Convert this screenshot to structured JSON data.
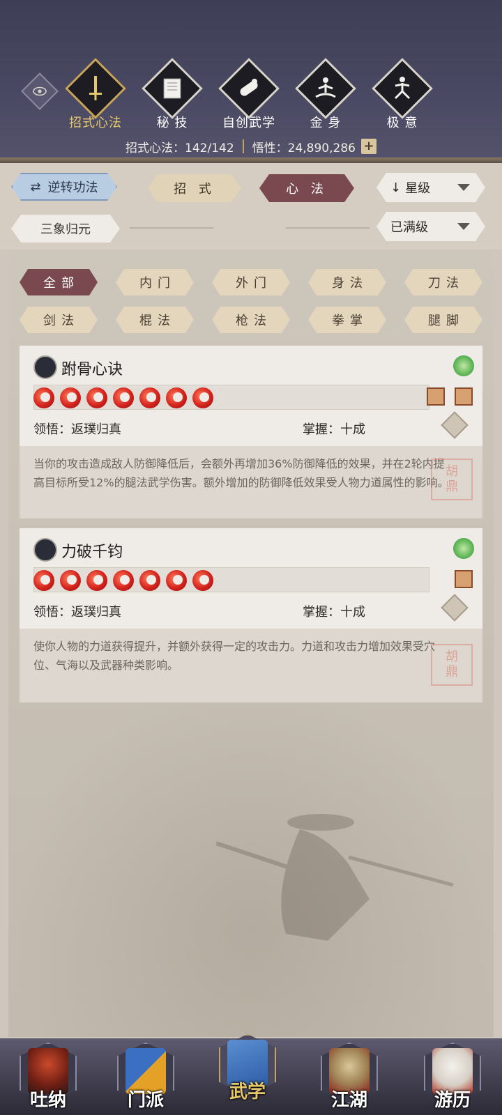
{
  "header": {
    "tabs": [
      {
        "label": "招式心法",
        "icon": "sword-icon",
        "active": true
      },
      {
        "label": "秘 技",
        "icon": "book-icon",
        "active": false
      },
      {
        "label": "自创武学",
        "icon": "scroll-icon",
        "active": false
      },
      {
        "label": "金 身",
        "icon": "meditation-icon",
        "active": false
      },
      {
        "label": "极 意",
        "icon": "martial-stance-icon",
        "active": false
      }
    ],
    "stats": {
      "skills_label": "招式心法：142/142",
      "insight_label": "悟性：24,890,286",
      "plus": "+"
    }
  },
  "controls": {
    "reverse_label": "逆转功法",
    "tab_moves": "招 式",
    "tab_mind": "心 法",
    "sort_select": "星级",
    "sort_arrow": "↓",
    "sanxiang_label": "三象归元",
    "level_select": "已满级"
  },
  "filters": [
    "全部",
    "内门",
    "外门",
    "身法",
    "刀法",
    "剑法",
    "棍法",
    "枪法",
    "拳掌",
    "腿脚"
  ],
  "cards": [
    {
      "name": "跗骨心诀",
      "stars": 7,
      "comprehension": "领悟：返璞归真",
      "mastery": "掌握：十成",
      "description": "当你的攻击造成敌人防御降低后，会额外再增加36%防御降低的效果，并在2轮内提高目标所受12%的腿法武学伤害。额外增加的防御降低效果受人物力道属性的影响。"
    },
    {
      "name": "力破千钧",
      "stars": 7,
      "comprehension": "领悟：返璞归真",
      "mastery": "掌握：十成",
      "description": "使你人物的力道获得提升，并额外获得一定的攻击力。力道和攻击力增加效果受穴位、气海以及武器种类影响。"
    }
  ],
  "nav": [
    {
      "label": "吐纳",
      "active": false
    },
    {
      "label": "门派",
      "active": false
    },
    {
      "label": "武学",
      "active": true
    },
    {
      "label": "江湖",
      "active": false
    },
    {
      "label": "游历",
      "active": false
    }
  ],
  "colors": {
    "header_bg": "#4a4963",
    "accent_gold": "#e7c96a",
    "active_plum": "#7a4950",
    "flame_red": "#d4231d"
  }
}
